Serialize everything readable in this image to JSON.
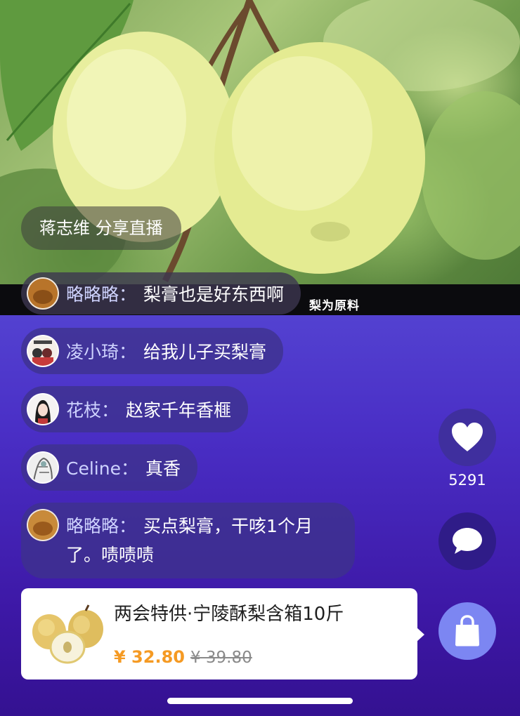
{
  "live": {
    "share_text": "蒋志维 分享直播",
    "subtitle": "梨为原料"
  },
  "chat": [
    {
      "user": "略略略",
      "message": "梨膏也是好东西啊",
      "avatar_icon": "avatar-lueluelue"
    },
    {
      "user": "凌小琦",
      "message": "给我儿子买梨膏",
      "avatar_icon": "avatar-anime-group"
    },
    {
      "user": "花枝",
      "message": "赵家千年香榧",
      "avatar_icon": "avatar-anime-girl"
    },
    {
      "user": "Celine",
      "message": "真香",
      "avatar_icon": "avatar-sketch"
    },
    {
      "user": "略略略",
      "message": "买点梨膏，干咳1个月了。啧啧啧",
      "avatar_icon": "avatar-lueluelue"
    }
  ],
  "chat_separator": "：",
  "actions": {
    "like_count": "5291",
    "like_icon": "heart-icon",
    "comment_icon": "comment-icon",
    "cart_icon": "shopping-bag-icon"
  },
  "product": {
    "title": "两会特供·宁陵酥梨含箱10斤",
    "price": "¥ 32.80",
    "original_price": "¥ 39.80",
    "price_color": "#f59a23"
  },
  "colors": {
    "background_top": "#6f74e6",
    "background_bottom": "#341191",
    "cart_button": "#7c86f2"
  }
}
